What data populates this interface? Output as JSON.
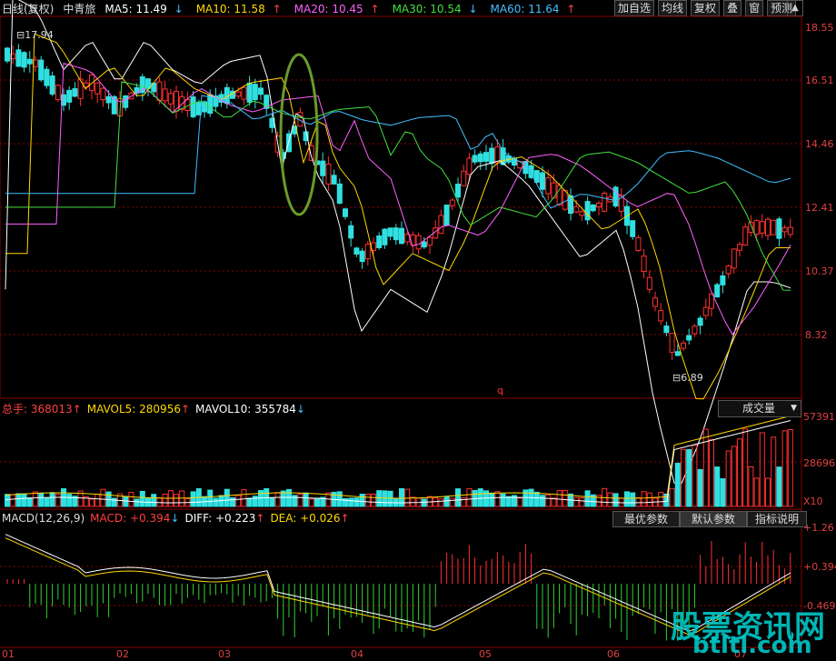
{
  "header": {
    "period": "日线(复权)",
    "stock": "中青旅",
    "ma": [
      {
        "label": "MA5: 11.49",
        "arrow": "↓",
        "color": "#ffffff"
      },
      {
        "label": "MA10: 11.58",
        "arrow": "↑",
        "color": "#ffd800"
      },
      {
        "label": "MA20: 10.45",
        "arrow": "↑",
        "color": "#ff60ff"
      },
      {
        "label": "MA30: 10.54",
        "arrow": "↓",
        "color": "#40e040"
      },
      {
        "label": "MA60: 11.64",
        "arrow": "↑",
        "color": "#40c0ff"
      }
    ],
    "buttons": [
      "加自选",
      "均线",
      "复权",
      "叠",
      "窗",
      "预测"
    ]
  },
  "price_axis": [
    "18.55",
    "16.51",
    "14.46",
    "12.41",
    "10.37",
    "8.32"
  ],
  "price_marks": {
    "high": "17.94",
    "low": "6.89",
    "q": "q"
  },
  "volume": {
    "total": "总手: 368013",
    "total_arrow": "↑",
    "mavol5": "MAVOL5: 280956",
    "mavol5_arrow": "↑",
    "mavol10": "MAVOL10: 355784",
    "mavol10_arrow": "↓",
    "dropdown": "成交量",
    "axis": [
      "57391",
      "28696",
      "X10"
    ]
  },
  "macd": {
    "title": "MACD(12,26,9)",
    "macd": "MACD: +0.394",
    "macd_arrow": "↓",
    "diff": "DIFF: +0.223",
    "diff_arrow": "↑",
    "dea": "DEA: +0.026",
    "dea_arrow": "↑",
    "tabs": [
      "最优参数",
      "默认参数",
      "指标说明"
    ],
    "axis": [
      "+1.26",
      "+0.394",
      "-0.469"
    ]
  },
  "xaxis": [
    "01",
    "02",
    "03",
    "04",
    "05",
    "06",
    "07"
  ],
  "watermark": {
    "line1": "股票资讯网",
    "line2": "btltl.com"
  },
  "colors": {
    "up": "#ff3030",
    "down": "#30e0e0",
    "grid": "#8b0000",
    "ellipse": "#6a9a2a"
  }
}
